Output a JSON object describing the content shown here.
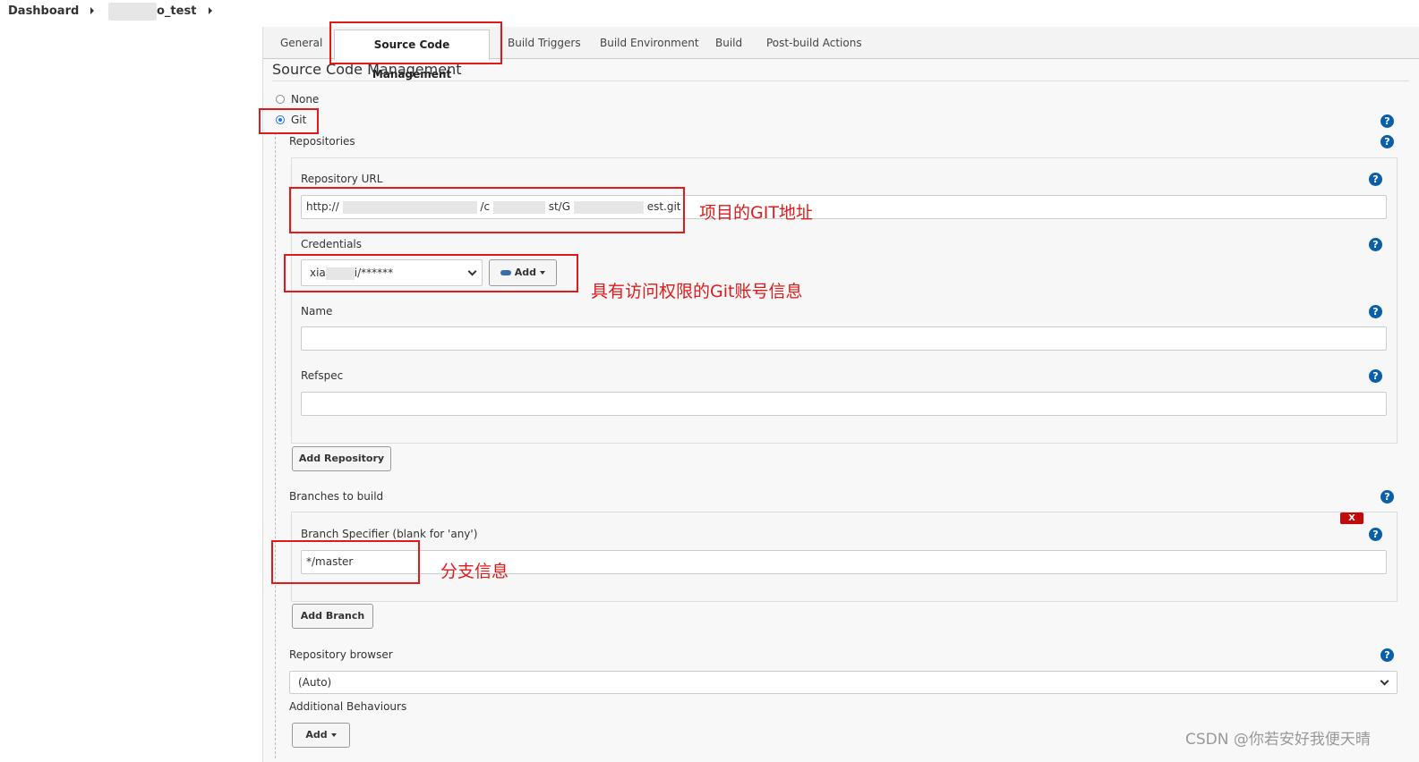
{
  "breadcrumb": {
    "dashboard": "Dashboard",
    "job_suffix": "o_test"
  },
  "tabs": {
    "general": "General",
    "scm": "Source Code Management",
    "triggers": "Build Triggers",
    "environment": "Build Environment",
    "build": "Build",
    "post_build": "Post-build Actions"
  },
  "section": {
    "title": "Source Code Management",
    "none_label": "None",
    "git_label": "Git",
    "repositories_label": "Repositories"
  },
  "repository": {
    "url_label": "Repository URL",
    "url_prefix": "http://",
    "url_mid1": "/c",
    "url_mid2": "st/G",
    "url_suffix": "est.git",
    "credentials_label": "Credentials",
    "credentials_prefix": "xia",
    "credentials_suffix": "i/******",
    "add_label": "Add",
    "name_label": "Name",
    "name_value": "",
    "refspec_label": "Refspec",
    "refspec_value": "",
    "add_repository_label": "Add Repository"
  },
  "branches": {
    "label": "Branches to build",
    "delete_label": "X",
    "specifier_label": "Branch Specifier (blank for 'any')",
    "specifier_value": "*/master",
    "add_branch_label": "Add Branch"
  },
  "browser": {
    "label": "Repository browser",
    "value": "(Auto)"
  },
  "behaviours": {
    "label": "Additional Behaviours",
    "add_label": "Add"
  },
  "annotations": {
    "git_url": "项目的GIT地址",
    "credentials": "具有访问权限的Git账号信息",
    "branch": "分支信息"
  },
  "watermark": "CSDN @你若安好我便天晴",
  "colors": {
    "highlight": "#e0191a",
    "help_icon": "#0a5fa8",
    "delete_button": "#c30a0a",
    "radio_selected": "#1a73e8"
  }
}
